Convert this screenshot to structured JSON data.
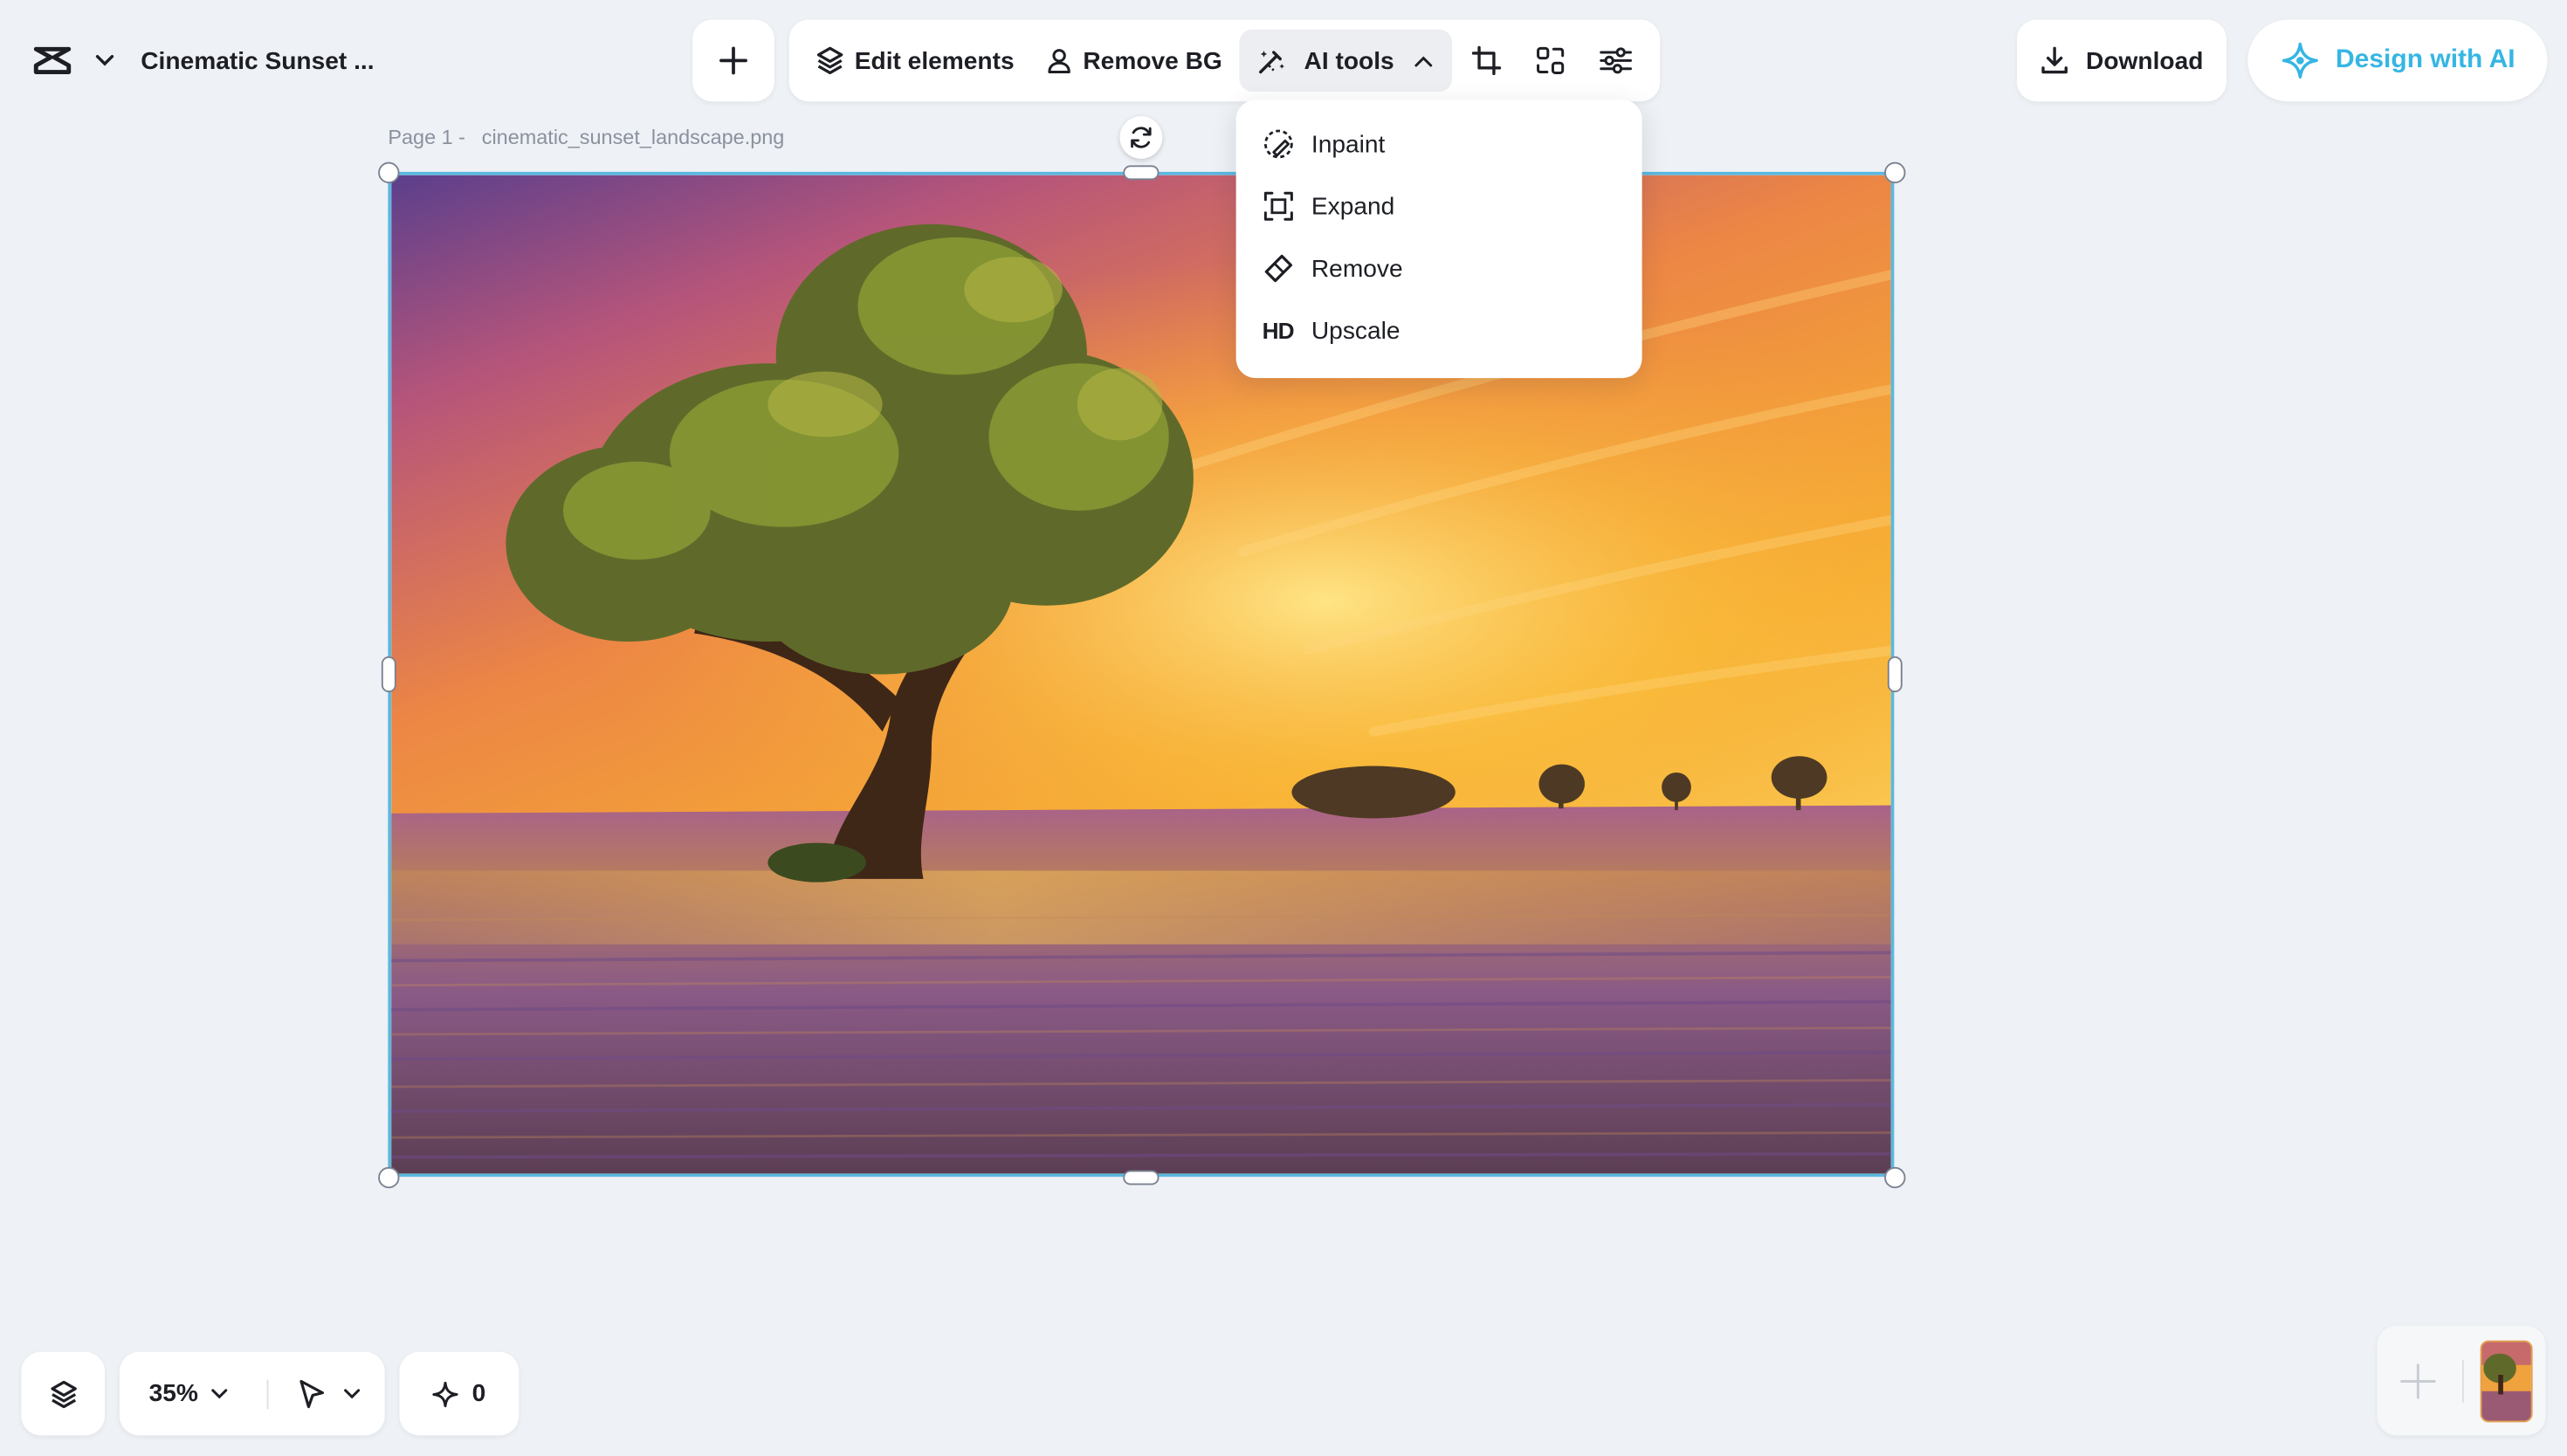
{
  "app": {
    "project_title": "Cinematic Sunset ...",
    "logo_icon": "capcut-logo-icon",
    "brand_color": "#35b6e3"
  },
  "toolbar": {
    "add_icon": "plus-icon",
    "edit_elements_label": "Edit elements",
    "remove_bg_label": "Remove BG",
    "ai_tools_label": "AI tools",
    "crop_icon": "crop-icon",
    "flip_icon": "flip-icon",
    "adjust_icon": "sliders-icon"
  },
  "ai_tools_menu": {
    "items": [
      {
        "label": "Inpaint",
        "icon": "inpaint-brush-icon"
      },
      {
        "label": "Expand",
        "icon": "expand-icon"
      },
      {
        "label": "Remove",
        "icon": "eraser-icon"
      },
      {
        "label": "Upscale",
        "icon": "hd-badge-icon",
        "badge": "HD"
      }
    ]
  },
  "header_right": {
    "download_label": "Download",
    "design_ai_label": "Design with AI"
  },
  "canvas": {
    "page_label": "Page 1 -",
    "file_name": "cinematic_sunset_landscape.png"
  },
  "bottom_bar": {
    "zoom": "35%",
    "ai_credits": "0"
  }
}
